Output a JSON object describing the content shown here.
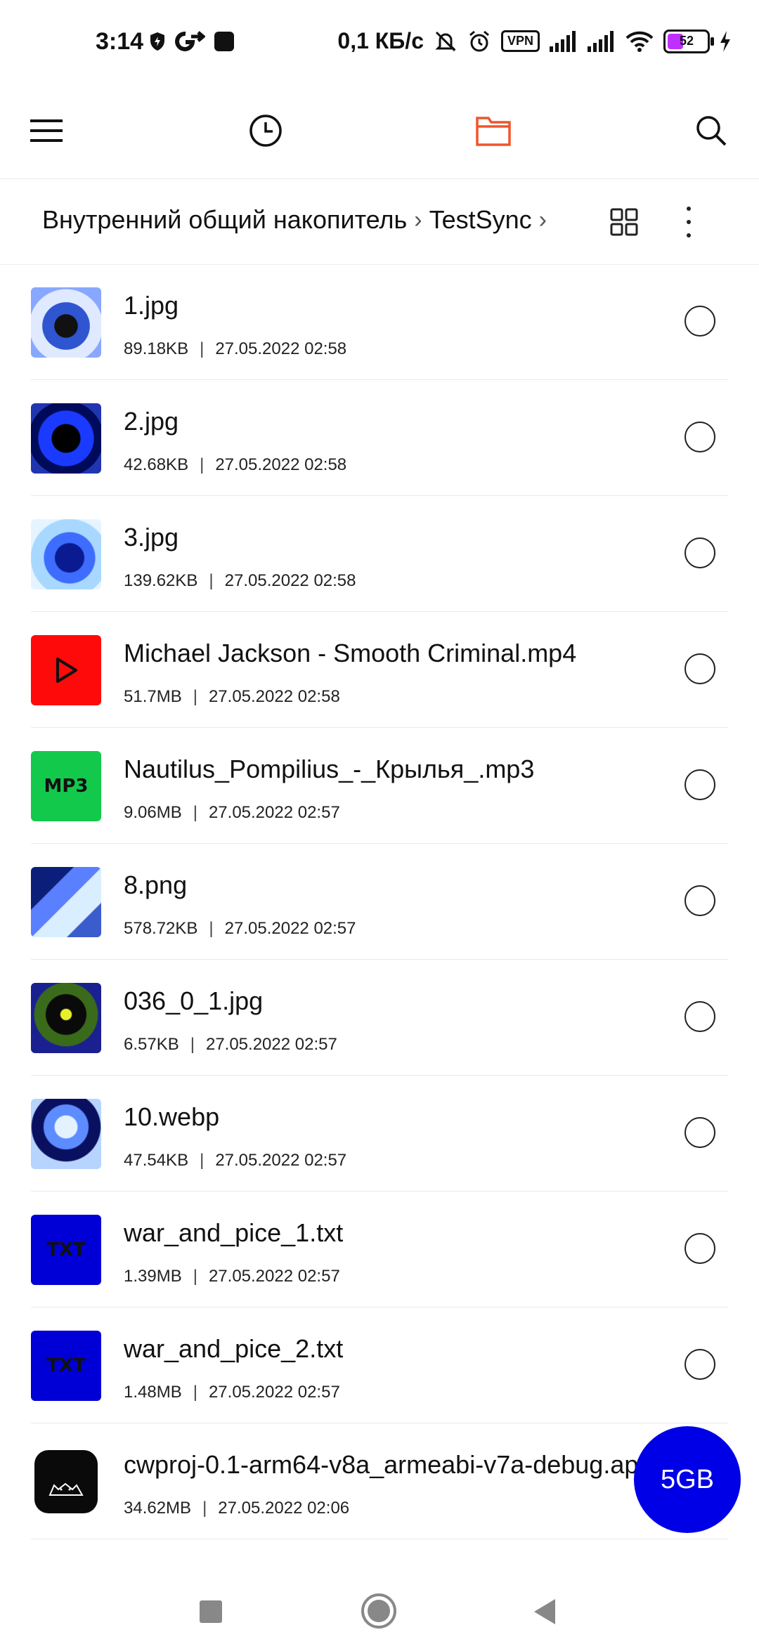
{
  "status_bar": {
    "time": "3:14",
    "net_speed": "0,1 КБ/с",
    "vpn_label": "VPN",
    "battery_level": "52"
  },
  "toolbar": {
    "menu_icon": "hamburger-menu-icon",
    "recent_icon": "clock-icon",
    "files_icon": "folder-icon",
    "search_icon": "search-icon",
    "accent_color": "#f0552b"
  },
  "breadcrumb": {
    "items": [
      "Внутренний общий накопитель",
      "TestSync"
    ]
  },
  "files": [
    {
      "name": "1.jpg",
      "size": "89.18KB",
      "date": "27.05.2022 02:58",
      "thumb": "image"
    },
    {
      "name": "2.jpg",
      "size": "42.68KB",
      "date": "27.05.2022 02:58",
      "thumb": "image"
    },
    {
      "name": "3.jpg",
      "size": "139.62KB",
      "date": "27.05.2022 02:58",
      "thumb": "image"
    },
    {
      "name": "Michael Jackson - Smooth Criminal.mp4",
      "size": "51.7MB",
      "date": "27.05.2022 02:58",
      "thumb": "video"
    },
    {
      "name": "Nautilus_Pompilius_-_Крылья_.mp3",
      "size": "9.06MB",
      "date": "27.05.2022 02:57",
      "thumb": "mp3",
      "thumb_label": "MP3"
    },
    {
      "name": "8.png",
      "size": "578.72KB",
      "date": "27.05.2022 02:57",
      "thumb": "image"
    },
    {
      "name": "036_0_1.jpg",
      "size": "6.57KB",
      "date": "27.05.2022 02:57",
      "thumb": "image"
    },
    {
      "name": "10.webp",
      "size": "47.54KB",
      "date": "27.05.2022 02:57",
      "thumb": "image"
    },
    {
      "name": "war_and_pice_1.txt",
      "size": "1.39MB",
      "date": "27.05.2022 02:57",
      "thumb": "txt",
      "thumb_label": "TXT"
    },
    {
      "name": "war_and_pice_2.txt",
      "size": "1.48MB",
      "date": "27.05.2022 02:57",
      "thumb": "txt",
      "thumb_label": "TXT"
    },
    {
      "name": "cwproj-0.1-arm64-v8a_armeabi-v7a-debug.apk",
      "size": "34.62MB",
      "date": "27.05.2022 02:06",
      "thumb": "apk"
    }
  ],
  "fab": {
    "label": "5GB",
    "color": "#0000e6"
  }
}
